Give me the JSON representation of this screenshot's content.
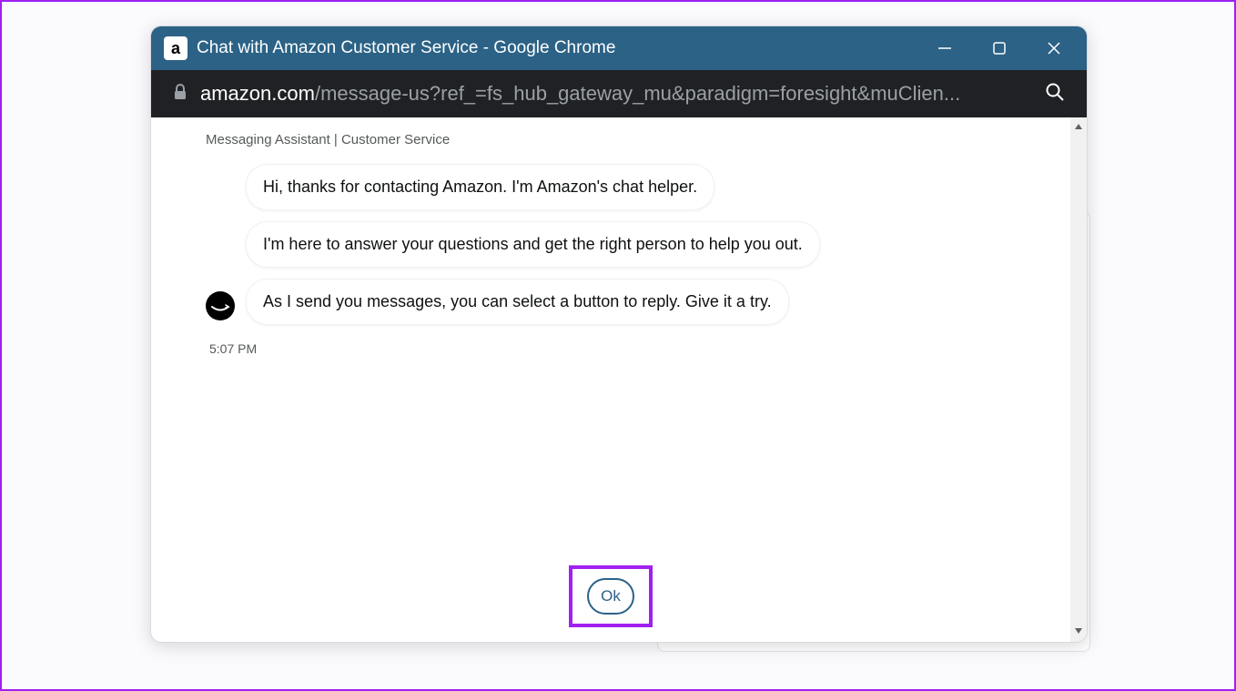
{
  "window": {
    "title": "Chat with Amazon Customer Service - Google Chrome",
    "favicon": "a"
  },
  "address": {
    "domain": "amazon.com",
    "path": "/message-us?ref_=fs_hub_gateway_mu&paradigm=foresight&muClien..."
  },
  "chat": {
    "header": "Messaging Assistant | Customer Service",
    "messages": [
      "Hi, thanks for contacting Amazon. I'm Amazon's chat helper.",
      "I'm here to answer your questions and get the right person to help you out.",
      "As I send you messages, you can select a button to reply.  Give it a try."
    ],
    "timestamp": "5:07 PM",
    "reply_button": "Ok"
  }
}
